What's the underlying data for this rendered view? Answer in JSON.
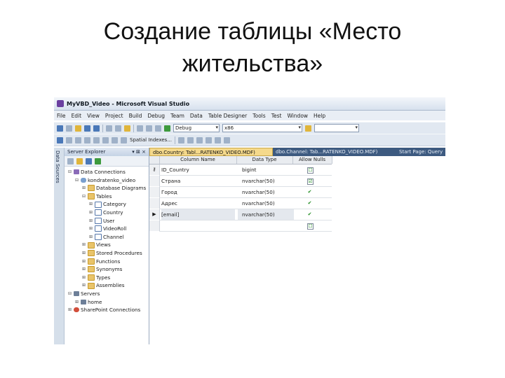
{
  "slide": {
    "title_line1": "Создание таблицы «Место",
    "title_line2": "жительства»"
  },
  "window": {
    "title": "MyVBD_Video - Microsoft Visual Studio"
  },
  "menu": [
    "File",
    "Edit",
    "View",
    "Project",
    "Build",
    "Debug",
    "Team",
    "Data",
    "Table Designer",
    "Tools",
    "Test",
    "Window",
    "Help"
  ],
  "toolbar": {
    "config_value": "Debug",
    "platform_value": "x86",
    "indexes_label": "Spatial Indexes..."
  },
  "vertical_tab": "Data Sources",
  "explorer": {
    "title": "Server Explorer",
    "pin_controls": "▾ ⊠ ×",
    "tree": [
      {
        "label": "Data Connections",
        "toggle": "⊟",
        "icon": "conn",
        "indent": 0
      },
      {
        "label": "kondratenko_video",
        "toggle": "⊟",
        "icon": "db",
        "indent": 1
      },
      {
        "label": "Database Diagrams",
        "toggle": "⊞",
        "icon": "folder",
        "indent": 2
      },
      {
        "label": "Tables",
        "toggle": "⊟",
        "icon": "folder",
        "indent": 2
      },
      {
        "label": "Category",
        "toggle": "⊞",
        "icon": "table",
        "indent": 3
      },
      {
        "label": "Country",
        "toggle": "⊞",
        "icon": "table",
        "indent": 3
      },
      {
        "label": "User",
        "toggle": "⊞",
        "icon": "table",
        "indent": 3
      },
      {
        "label": "VideoRoll",
        "toggle": "⊞",
        "icon": "table",
        "indent": 3
      },
      {
        "label": "Channel",
        "toggle": "⊞",
        "icon": "table",
        "indent": 3
      },
      {
        "label": "Views",
        "toggle": "⊞",
        "icon": "folder",
        "indent": 2
      },
      {
        "label": "Stored Procedures",
        "toggle": "⊞",
        "icon": "folder",
        "indent": 2
      },
      {
        "label": "Functions",
        "toggle": "⊞",
        "icon": "folder",
        "indent": 2
      },
      {
        "label": "Synonyms",
        "toggle": "⊞",
        "icon": "folder",
        "indent": 2
      },
      {
        "label": "Types",
        "toggle": "⊞",
        "icon": "folder",
        "indent": 2
      },
      {
        "label": "Assemblies",
        "toggle": "⊞",
        "icon": "folder",
        "indent": 2
      },
      {
        "label": "Servers",
        "toggle": "⊟",
        "icon": "server",
        "indent": 0
      },
      {
        "label": "home",
        "toggle": "⊞",
        "icon": "server",
        "indent": 1
      },
      {
        "label": "SharePoint Connections",
        "toggle": "⊞",
        "icon": "sp",
        "indent": 0
      }
    ]
  },
  "tabs": {
    "active": "dbo.Country: Tabl...RATENKO_VIDEO.MDF)",
    "inactive1": "dbo.Channel: Tab...RATENKO_VIDEO.MDF)",
    "inactive2": "Start Page: Query"
  },
  "designer": {
    "headers": [
      "Column Name",
      "Data Type",
      "Allow Nulls"
    ],
    "rows": [
      {
        "marker": "⚷",
        "name": "ID_Country",
        "type": "bigint",
        "nulls": "☐"
      },
      {
        "marker": "",
        "name": "Страна",
        "type": "nvarchar(50)",
        "nulls": "☑"
      },
      {
        "marker": "",
        "name": "Город",
        "type": "nvarchar(50)",
        "nulls": "✔"
      },
      {
        "marker": "",
        "name": "Адрес",
        "type": "nvarchar(50)",
        "nulls": "✔"
      },
      {
        "marker": "▶",
        "name": "[email]",
        "type": "nvarchar(50)",
        "nulls": "✔"
      },
      {
        "marker": "",
        "name": "",
        "type": "",
        "nulls": "☐"
      }
    ]
  },
  "colors": {
    "tab_active": "#f5d98b",
    "tab_strip": "#3d5a80",
    "chrome": "#e1e8f1"
  }
}
